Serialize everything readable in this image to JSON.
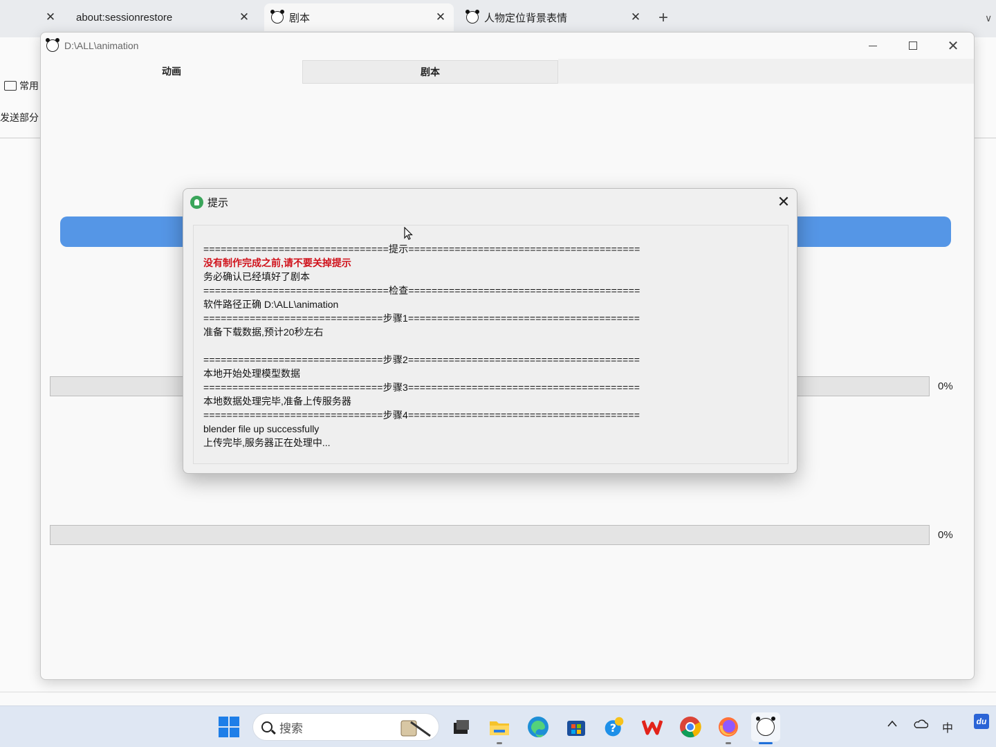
{
  "browser": {
    "tabs": [
      {
        "label": "about:sessionrestore",
        "close": "✕"
      },
      {
        "label": "剧本",
        "close": "✕"
      },
      {
        "label": "人物定位背景表情",
        "close": "✕"
      }
    ],
    "new_tab": "+",
    "tab_list": "∨",
    "leading_close": "✕"
  },
  "background_page": {
    "folder_label": "常用",
    "text_fragment": "发送部分"
  },
  "app": {
    "title": "D:\\ALL\\animation",
    "tabs": [
      "动画",
      "剧本"
    ],
    "progress": [
      {
        "percent_label": "0%",
        "value": 0
      },
      {
        "percent_label": "0%",
        "value": 0
      }
    ],
    "colors": {
      "accent_bar": "#5596e6"
    }
  },
  "dialog": {
    "title": "提示",
    "close": "✕",
    "lines": [
      {
        "text": "================================提示========================================",
        "kind": "sep"
      },
      {
        "text": "没有制作完成之前,请不要关掉提示",
        "kind": "warn"
      },
      {
        "text": "务必确认已经填好了剧本",
        "kind": "normal"
      },
      {
        "text": "================================检查========================================",
        "kind": "sep"
      },
      {
        "text": "软件路径正确 D:\\ALL\\animation",
        "kind": "normal"
      },
      {
        "text": "===============================步骤1========================================",
        "kind": "sep"
      },
      {
        "text": "准备下载数据,预计20秒左右",
        "kind": "normal"
      },
      {
        "text": "",
        "kind": "normal"
      },
      {
        "text": "===============================步骤2========================================",
        "kind": "sep"
      },
      {
        "text": "本地开始处理模型数据",
        "kind": "normal"
      },
      {
        "text": "===============================步骤3========================================",
        "kind": "sep"
      },
      {
        "text": "本地数据处理完毕,准备上传服务器",
        "kind": "normal"
      },
      {
        "text": "===============================步骤4========================================",
        "kind": "sep"
      },
      {
        "text": "blender file up successfully",
        "kind": "normal"
      },
      {
        "text": "上传完毕,服务器正在处理中...",
        "kind": "normal"
      }
    ],
    "colors": {
      "warn": "#d0121b"
    }
  },
  "taskbar": {
    "search_placeholder": "搜索",
    "ime_indicator": "中",
    "apps": [
      "start-icon",
      "file-explorer-icon",
      "edge-icon",
      "store-icon",
      "help-icon",
      "wps-icon",
      "chrome-icon",
      "firefox-icon",
      "panda-app-icon"
    ],
    "tray": [
      "chevron-up-icon",
      "onedrive-icon",
      "ime-icon",
      "baidu-icon"
    ],
    "baidu_label": "du"
  }
}
